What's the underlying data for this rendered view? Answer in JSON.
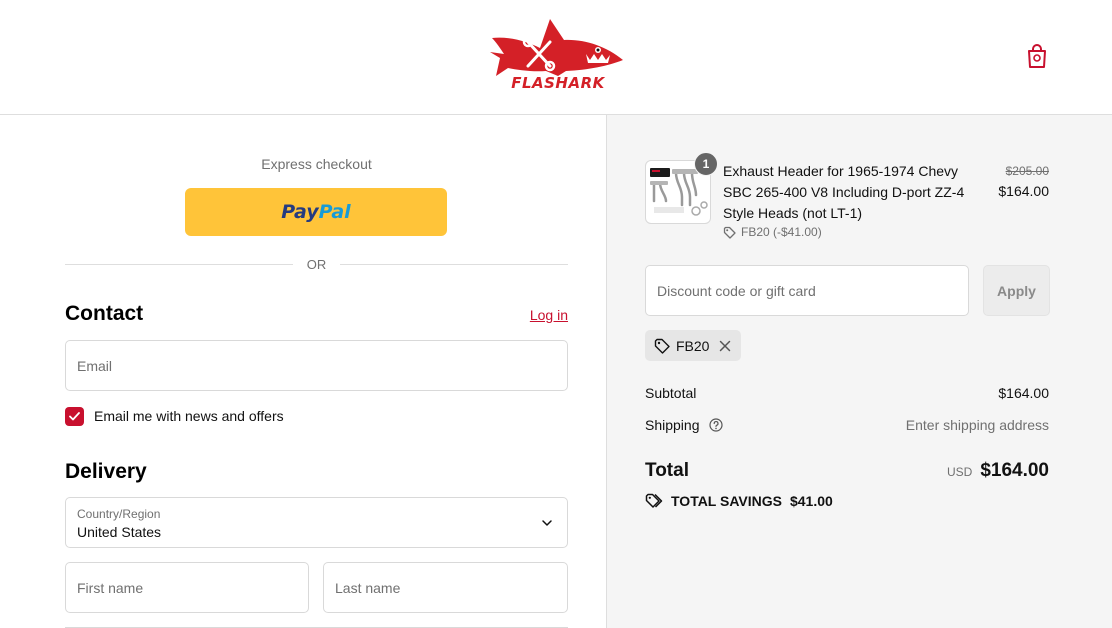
{
  "brand": {
    "logo_text": "FLASHARK",
    "accent": "#c8102e",
    "logo_red": "#d42027"
  },
  "header": {
    "cart_icon": "shopping-bag-icon"
  },
  "express": {
    "label": "Express checkout",
    "paypal_part1": "Pay",
    "paypal_part2": "Pal"
  },
  "divider": {
    "or_text": "OR"
  },
  "contact": {
    "title": "Contact",
    "login_label": "Log in",
    "email_placeholder": "Email",
    "newsletter_label": "Email me with news and offers",
    "newsletter_checked": true
  },
  "delivery": {
    "title": "Delivery",
    "country_label": "Country/Region",
    "country_value": "United States",
    "first_name_placeholder": "First name",
    "last_name_placeholder": "Last name"
  },
  "order": {
    "item": {
      "quantity": "1",
      "name": "Exhaust Header for 1965-1974 Chevy SBC 265-400 V8 Including D-port ZZ-4 Style Heads (not LT-1)",
      "discount_text": "FB20 (-$41.00)",
      "original_price": "$205.00",
      "price": "$164.00"
    },
    "discount": {
      "placeholder": "Discount code or gift card",
      "apply_label": "Apply",
      "applied_code": "FB20"
    },
    "subtotal_label": "Subtotal",
    "subtotal_value": "$164.00",
    "shipping_label": "Shipping",
    "shipping_value": "Enter shipping address",
    "total_label": "Total",
    "currency": "USD",
    "total_value": "$164.00",
    "savings_label": "TOTAL SAVINGS",
    "savings_value": "$41.00"
  }
}
